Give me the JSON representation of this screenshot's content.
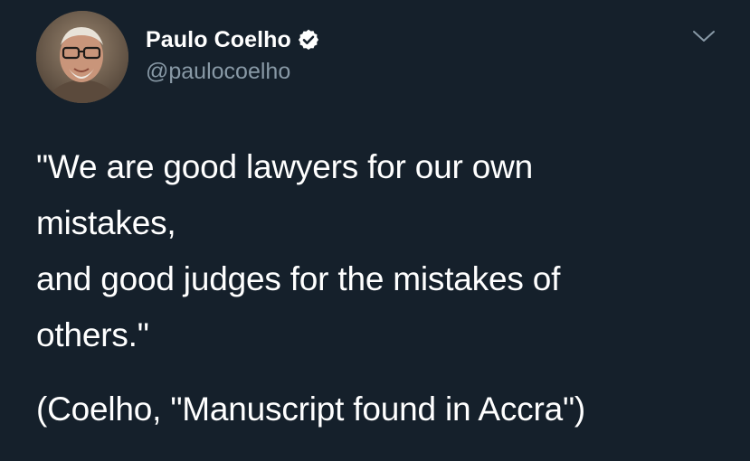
{
  "author": {
    "display_name": "Paulo Coelho",
    "handle": "@paulocoelho",
    "verified": true,
    "avatar_icon": "author-portrait"
  },
  "tweet": {
    "lines": [
      "\"We are good lawyers for our own",
      "mistakes,",
      "and good judges for the mistakes of",
      "others.\""
    ],
    "citation": "(Coelho, \"Manuscript found in Accra\")"
  },
  "menu": {
    "icon": "chevron-down-icon"
  },
  "colors": {
    "background": "#15202b",
    "text_primary": "#ffffff",
    "text_secondary": "#8899a6",
    "verified_badge": "#ffffff"
  }
}
